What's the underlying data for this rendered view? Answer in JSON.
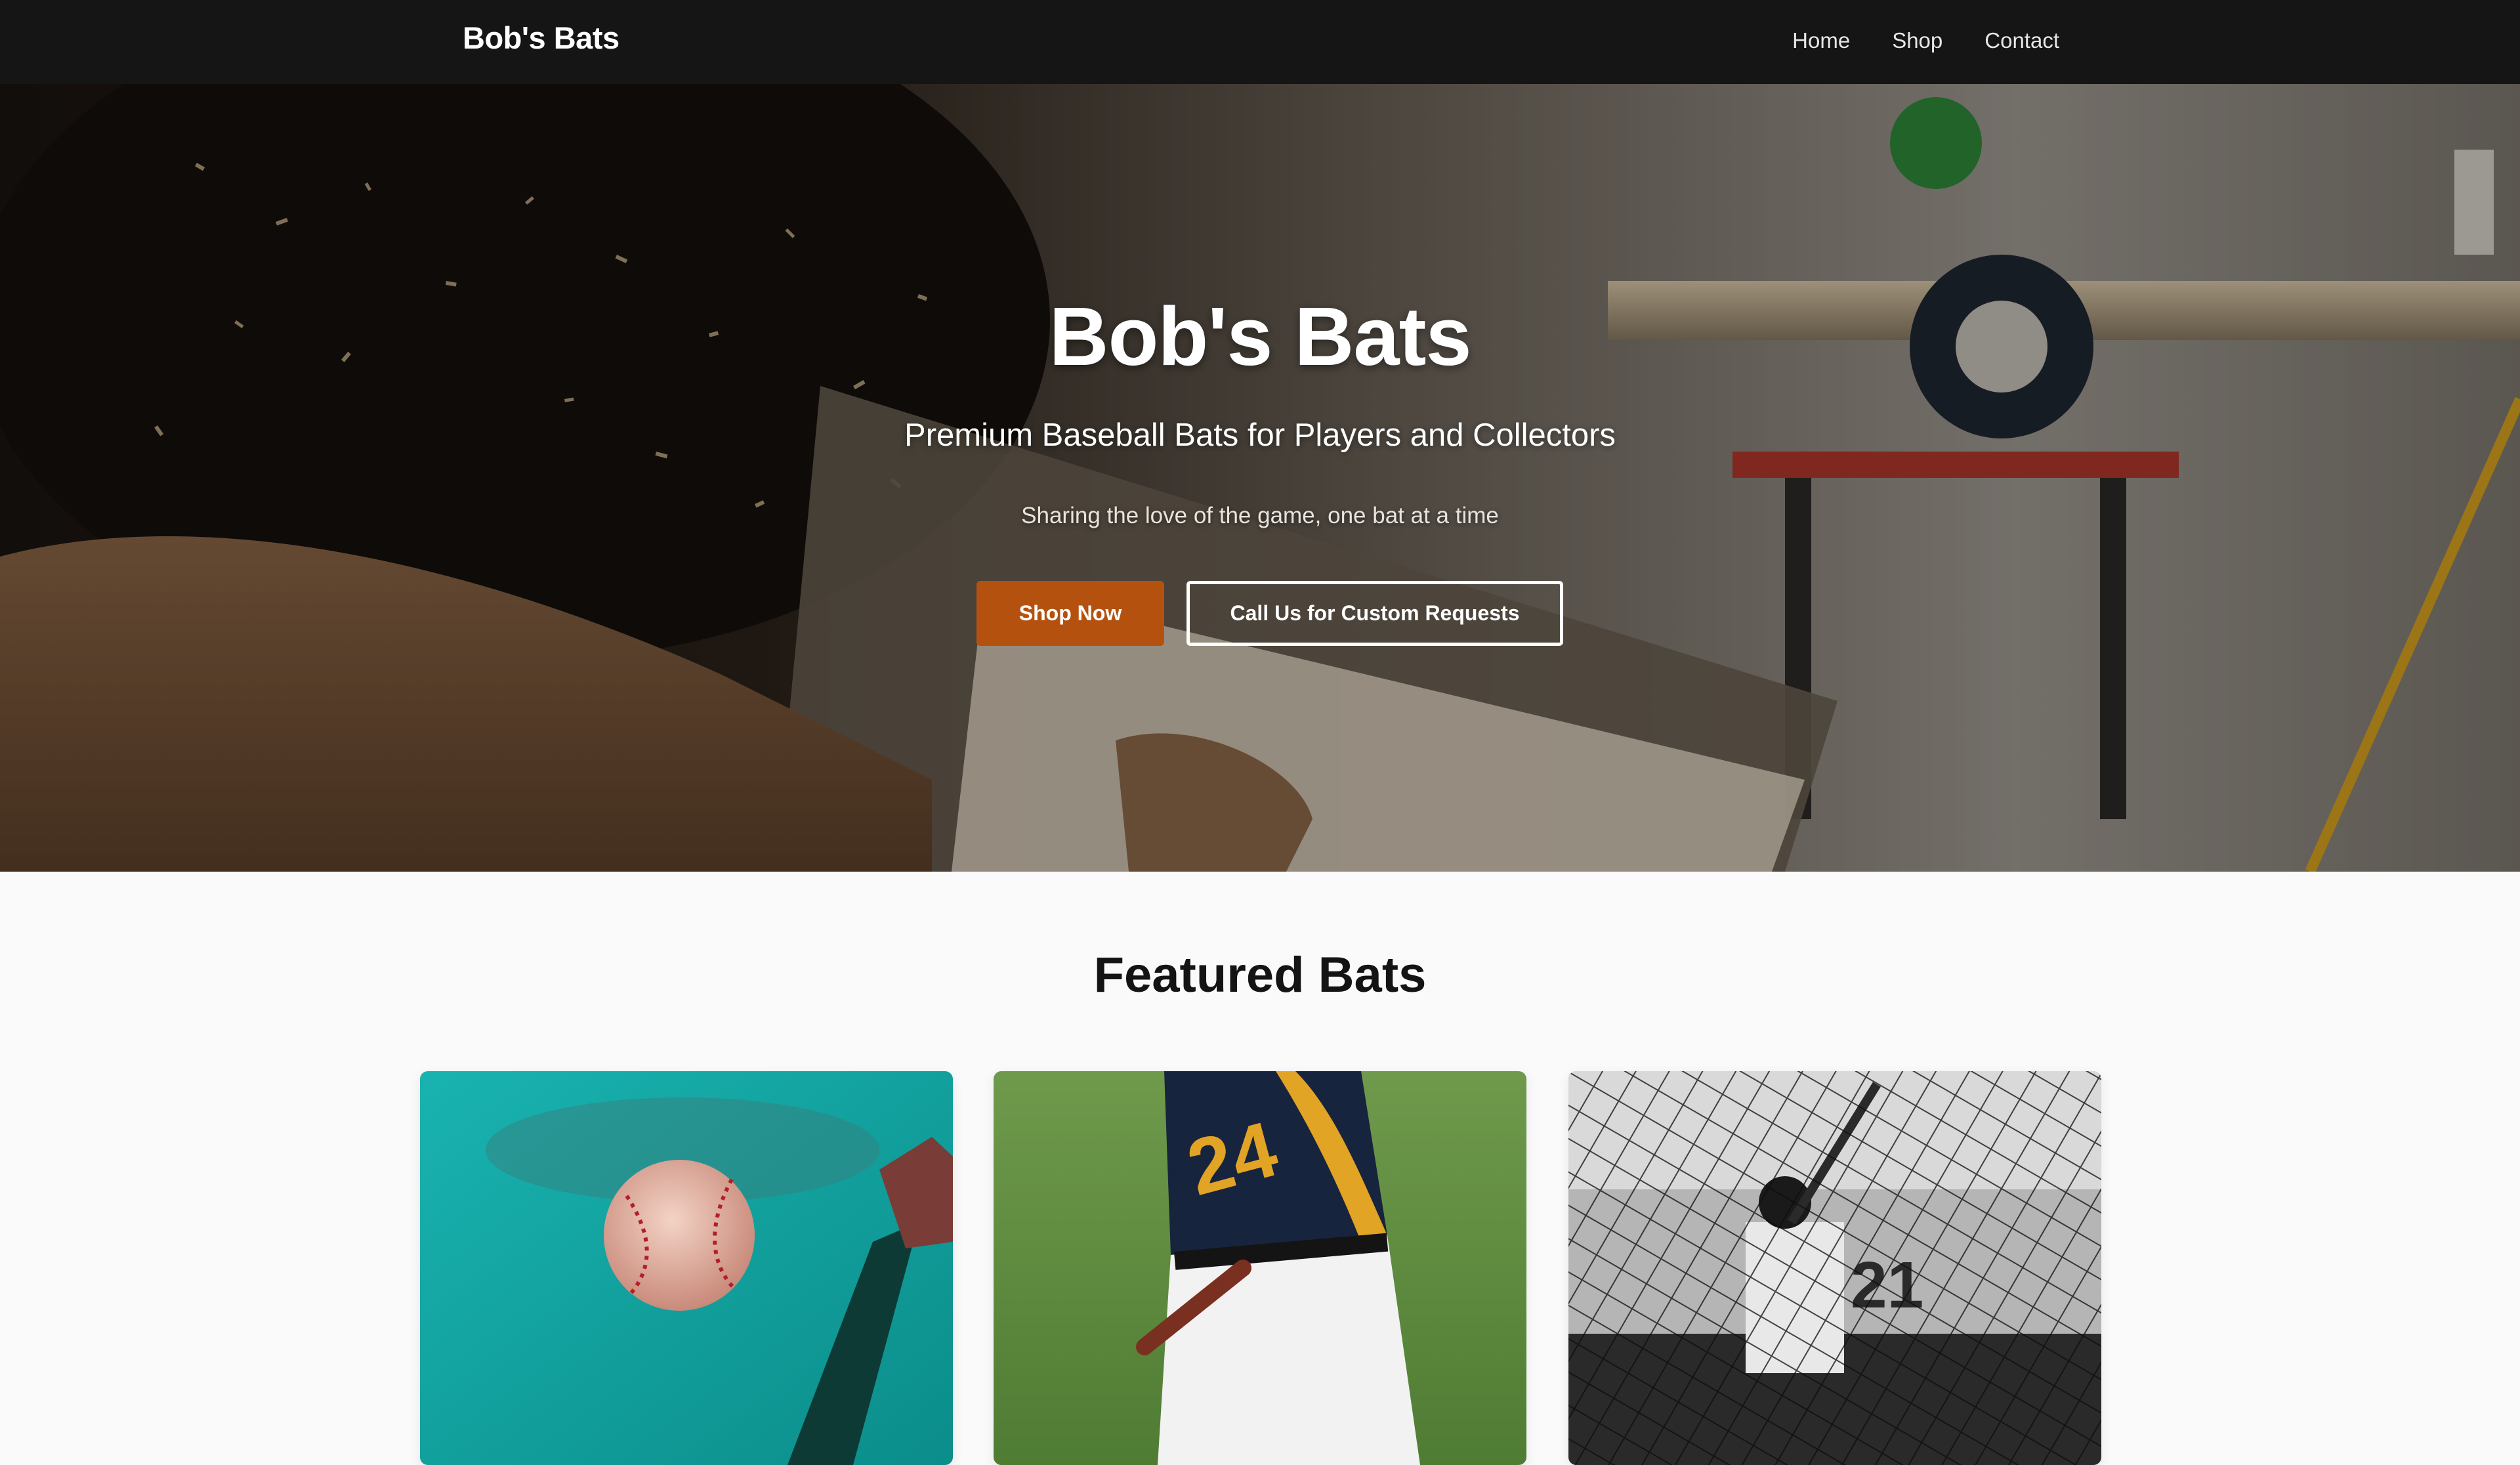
{
  "nav": {
    "brand": "Bob's Bats",
    "links": [
      "Home",
      "Shop",
      "Contact"
    ]
  },
  "hero": {
    "title": "Bob's Bats",
    "subtitle": "Premium Baseball Bats for Players and Collectors",
    "tagline": "Sharing the love of the game, one bat at a time",
    "primary_button": "Shop Now",
    "secondary_button": "Call Us for Custom Requests"
  },
  "featured": {
    "title": "Featured Bats",
    "cards": [
      {
        "image": "baseball-and-bat-photo"
      },
      {
        "image": "batter-number-24-photo"
      },
      {
        "image": "batting-cage-photo"
      }
    ]
  },
  "colors": {
    "nav_bg": "#151515",
    "accent": "#b5510f",
    "page_bg": "#fafafa"
  }
}
